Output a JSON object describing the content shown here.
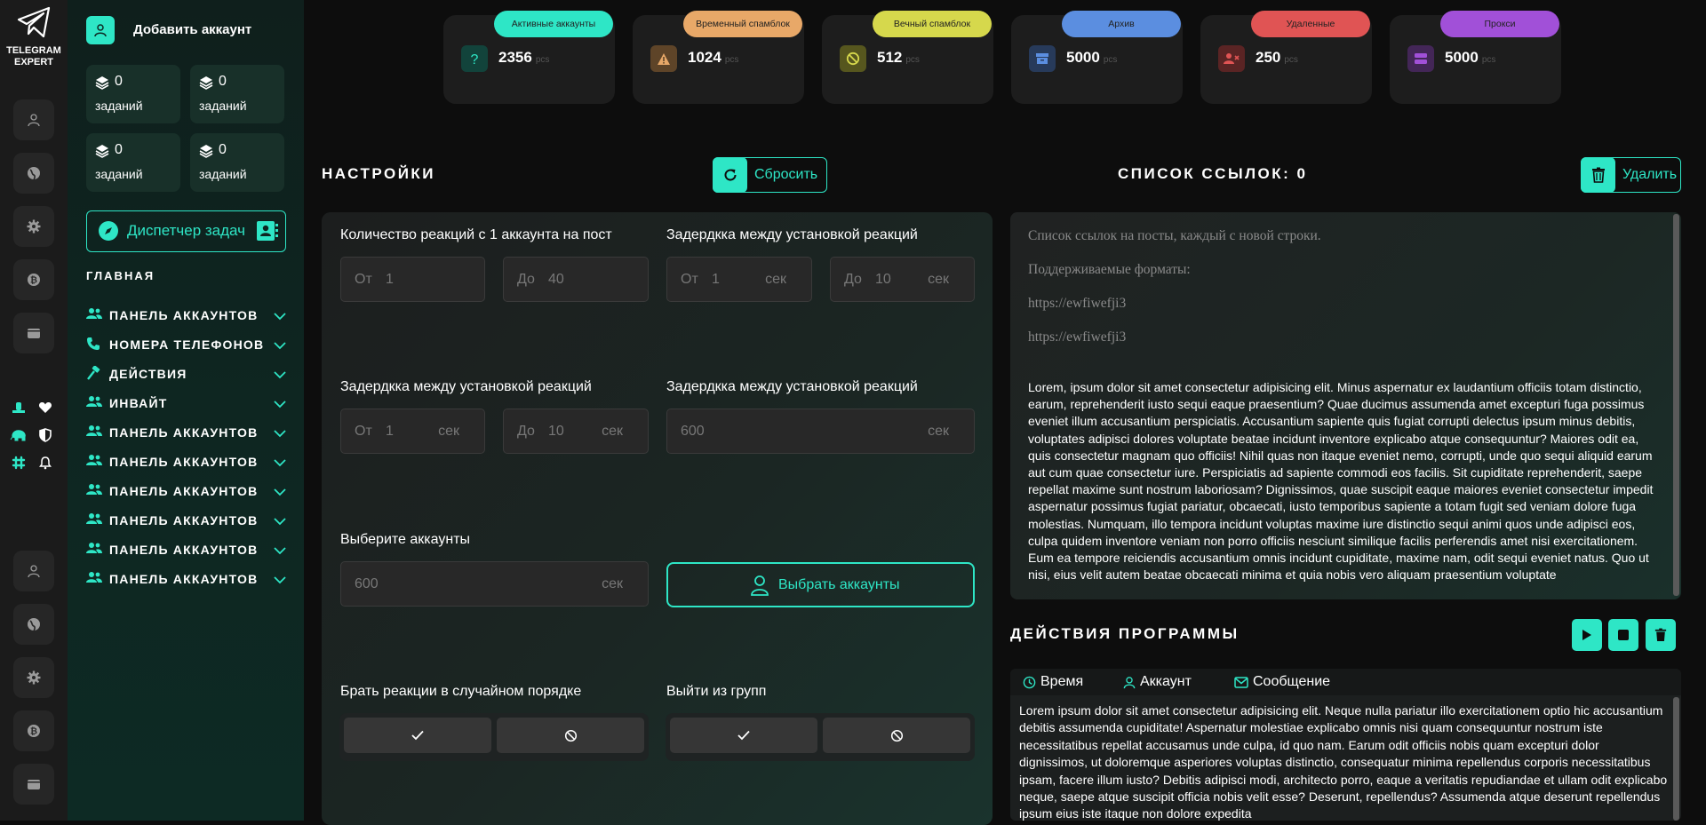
{
  "brand": {
    "line1": "TELEGRAM",
    "line2": "EXPERT"
  },
  "colors": {
    "accent": "#2ee6c6",
    "active": "#2ee6c6",
    "temp_spamblock": "#e8a868",
    "eternal_spamblock": "#d6d84c",
    "archive": "#5b8ee0",
    "deleted": "#e05454",
    "proxy": "#a150d8"
  },
  "rail": {
    "top_icons": [
      "user-icon",
      "globe-icon",
      "gear-icon",
      "bitcoin-icon",
      "wallet-icon"
    ],
    "bottom_icons": [
      "user-icon",
      "globe-icon",
      "gear-icon",
      "bitcoin-icon",
      "wallet-icon"
    ],
    "mini_icons": [
      "stamp-icon",
      "heart-icon",
      "elephant-icon",
      "shield-icon",
      "slack-icon",
      "bell-icon"
    ]
  },
  "sidebar": {
    "add_account": "Добавить аккаунт",
    "task_boxes": [
      {
        "value": "0",
        "label": "заданий"
      },
      {
        "value": "0",
        "label": "заданий"
      },
      {
        "value": "0",
        "label": "заданий"
      },
      {
        "value": "0",
        "label": "заданий"
      }
    ],
    "dispatcher": "Диспетчер задач",
    "section": "ГЛАВНАЯ",
    "items": [
      {
        "label": "ПАНЕЛЬ АККАУНТОВ",
        "icon": "users-icon"
      },
      {
        "label": "НОМЕРА ТЕЛЕФОНОВ",
        "icon": "phone-icon"
      },
      {
        "label": "ДЕЙСТВИЯ",
        "icon": "hammer-icon"
      },
      {
        "label": "ИНВАЙТ",
        "icon": "users-icon"
      },
      {
        "label": "ПАНЕЛЬ АККАУНТОВ",
        "icon": "users-icon"
      },
      {
        "label": "ПАНЕЛЬ АККАУНТОВ",
        "icon": "users-icon"
      },
      {
        "label": "ПАНЕЛЬ АККАУНТОВ",
        "icon": "users-icon"
      },
      {
        "label": "ПАНЕЛЬ АККАУНТОВ",
        "icon": "users-icon"
      },
      {
        "label": "ПАНЕЛЬ АККАУНТОВ",
        "icon": "users-icon"
      },
      {
        "label": "ПАНЕЛЬ АККАУНТОВ",
        "icon": "users-icon"
      }
    ]
  },
  "stats": [
    {
      "label": "Активные аккаунты",
      "value": "2356",
      "unit": "pcs",
      "icon": "question-icon"
    },
    {
      "label": "Временный спамблок",
      "value": "1024",
      "unit": "pcs",
      "icon": "warning-icon"
    },
    {
      "label": "Вечный спамблок",
      "value": "512",
      "unit": "pcs",
      "icon": "ban-icon"
    },
    {
      "label": "Архив",
      "value": "5000",
      "unit": "pcs",
      "icon": "archive-icon"
    },
    {
      "label": "Удаленные",
      "value": "250",
      "unit": "pcs",
      "icon": "user-x-icon"
    },
    {
      "label": "Прокси",
      "value": "5000",
      "unit": "pcs",
      "icon": "server-icon"
    }
  ],
  "settings": {
    "title": "НАСТРОЙКИ",
    "reset": "Сбросить",
    "reactions_label": "Количество реакций с 1 аккаунта на пост",
    "reactions_from": {
      "prefix": "От",
      "value": "1"
    },
    "reactions_to": {
      "prefix": "До",
      "value": "40"
    },
    "delay1_label": "Задердкка между установкой реакций",
    "delay1_from": {
      "prefix": "От",
      "value": "1",
      "suffix": "сек"
    },
    "delay1_to": {
      "prefix": "До",
      "value": "10",
      "suffix": "сек"
    },
    "delay2_label": "Задердкка между установкой реакций",
    "delay2_from": {
      "prefix": "От",
      "value": "1",
      "suffix": "сек"
    },
    "delay2_to": {
      "prefix": "До",
      "value": "10",
      "suffix": "сек"
    },
    "delay3_label": "Задердкка между установкой реакций",
    "delay3": {
      "value": "600",
      "suffix": "сек"
    },
    "accounts_label": "Выберите аккаунты",
    "accounts": {
      "value": "600",
      "suffix": "сек"
    },
    "choose_accounts": "Выбрать аккаунты",
    "random_label": "Брать реакции в случайном порядке",
    "leave_label": "Выйти из групп"
  },
  "links": {
    "title": "СПИСОК ССЫЛОК: 0",
    "delete": "Удалить",
    "placeholder_lines": [
      "Список ссылок на посты, каждый с новой строки.",
      "Поддерживаемые форматы:",
      "https://ewfiwefji3",
      "https://ewfiwefji3"
    ],
    "lorem": "Lorem, ipsum dolor sit amet consectetur adipisicing elit. Minus aspernatur ex laudantium officiis totam distinctio, earum, reprehenderit iusto sequi eaque praesentium? Quae ducimus assumenda amet excepturi fuga possimus eveniet illum accusantium perspiciatis. Accusantium sapiente quis fugiat corrupti delectus ipsum minus debitis, voluptates adipisci dolores voluptate beatae incidunt inventore explicabo atque consequuntur? Maiores odit ea, quis consectetur magnam quo officiis! Nihil quas non itaque eveniet nemo, corrupti, unde quo sequi aliquid earum aut cum quae consectetur iure. Perspiciatis ad sapiente commodi eos facilis. Sit cupiditate reprehenderit, saepe repellat maxime sunt nostrum laboriosam? Dignissimos, quae suscipit eaque maiores eveniet consectetur impedit aspernatur possimus fugiat pariatur, obcaecati, iusto temporibus sapiente a totam fugit sed veniam dolore fuga molestias. Numquam, illo tempora incidunt voluptas maxime iure distinctio sequi animi quos unde adipisci eos, culpa quidem inventore veniam non porro officiis nesciunt similique facilis perferendis amet nisi exercitationem. Eum ea tempore reiciendis accusantium omnis incidunt cupiditate, maxime nam, odit sequi eveniet natus. Quo ut nisi, eius velit autem beatae obcaecati minima et quia nobis vero aliquam praesentium voluptate"
  },
  "actions": {
    "title": "ДЕЙСТВИЯ ПРОГРАММЫ",
    "columns": [
      {
        "label": "Время",
        "icon": "clock-icon"
      },
      {
        "label": "Аккаунт",
        "icon": "user-icon"
      },
      {
        "label": "Сообщение",
        "icon": "mail-icon"
      }
    ],
    "log": "Lorem ipsum dolor sit amet consectetur adipisicing elit. Neque nulla pariatur illo exercitationem optio hic accusantium debitis assumenda cupiditate! Aspernatur molestiae explicabo omnis nisi quam consequuntur nostrum iste necessitatibus repellat accusamus unde culpa, id quo nam. Earum odit officiis nobis quam excepturi dolor dignissimos, ut doloremque asperiores voluptas distinctio, consequatur minima repellendus corporis necessitatibus ipsam, facere illum iusto? Debitis adipisci modi, architecto porro, eaque a veritatis repudiandae et ullam odit explicabo neque, saepe atque suscipit officia nobis velit esse? Deserunt, repellendus? Assumenda atque deserunt repellendus ipsum eius iste itaque non dolore expedita"
  }
}
